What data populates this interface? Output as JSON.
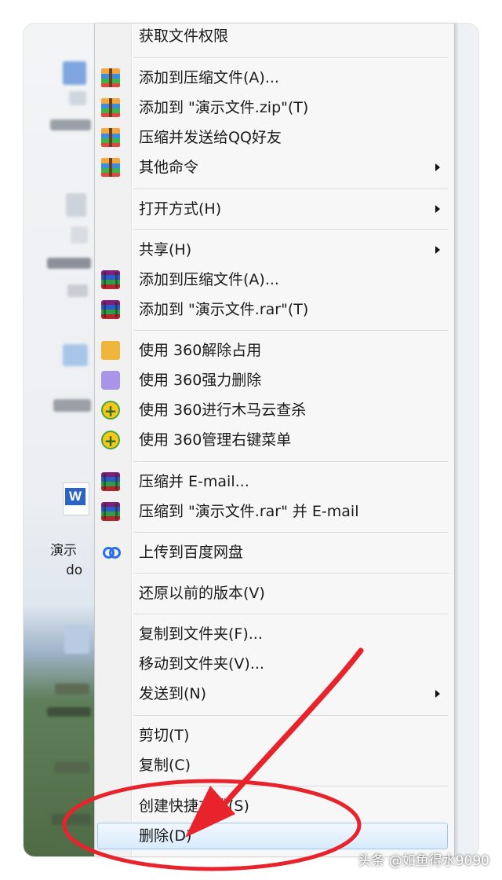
{
  "menu": {
    "items": [
      {
        "label": "获取文件权限",
        "icon": "none"
      },
      {
        "label": "添加到压缩文件(A)...",
        "icon": "winzip-icon"
      },
      {
        "label": "添加到 \"演示文件.zip\"(T)",
        "icon": "winzip-icon"
      },
      {
        "label": "压缩并发送给QQ好友",
        "icon": "winzip-icon"
      },
      {
        "label": "其他命令",
        "icon": "winzip-icon",
        "submenu": true
      },
      {
        "label": "打开方式(H)",
        "icon": "none",
        "submenu": true
      },
      {
        "label": "共享(H)",
        "icon": "none",
        "submenu": true
      },
      {
        "label": "添加到压缩文件(A)...",
        "icon": "winrar-icon"
      },
      {
        "label": "添加到 \"演示文件.rar\"(T)",
        "icon": "winrar-icon"
      },
      {
        "label": "使用 360解除占用",
        "icon": "360-unlock-icon"
      },
      {
        "label": "使用 360强力删除",
        "icon": "360-shred-icon"
      },
      {
        "label": "使用 360进行木马云查杀",
        "icon": "360-scan-icon"
      },
      {
        "label": "使用 360管理右键菜单",
        "icon": "360-scan-icon"
      },
      {
        "label": "压缩并 E-mail...",
        "icon": "winrar-icon"
      },
      {
        "label": "压缩到 \"演示文件.rar\" 并 E-mail",
        "icon": "winrar-icon"
      },
      {
        "label": "上传到百度网盘",
        "icon": "baidu-netdisk-icon"
      },
      {
        "label": "还原以前的版本(V)",
        "icon": "none"
      },
      {
        "label": "复制到文件夹(F)...",
        "icon": "none"
      },
      {
        "label": "移动到文件夹(V)...",
        "icon": "none"
      },
      {
        "label": "发送到(N)",
        "icon": "none",
        "submenu": true
      },
      {
        "label": "剪切(T)",
        "icon": "none"
      },
      {
        "label": "复制(C)",
        "icon": "none"
      },
      {
        "label": "创建快捷方式(S)",
        "icon": "none"
      },
      {
        "label": "删除(D)",
        "icon": "none",
        "highlighted": true
      }
    ]
  },
  "desktop": {
    "file_icon": "word-document-icon",
    "file_label_line1": "演示",
    "file_label_line2": "do"
  },
  "annotation": {
    "color": "#e8232b"
  },
  "watermark": "头条 @如鱼得水9090"
}
